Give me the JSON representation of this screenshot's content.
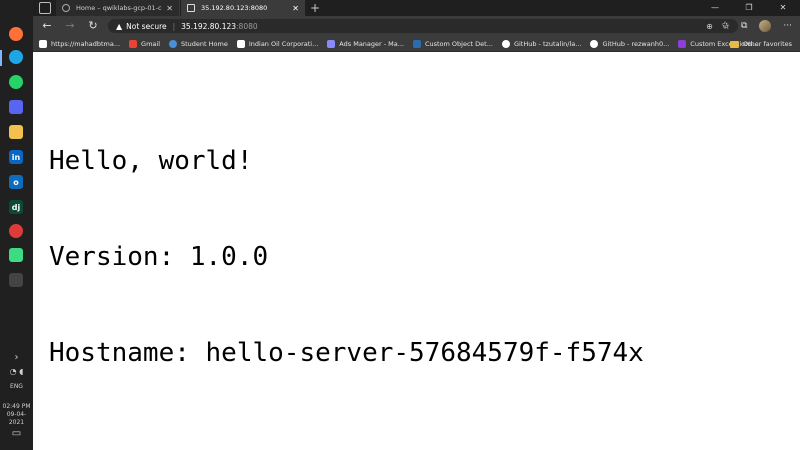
{
  "browser": {
    "tabs": [
      {
        "title": "Home – qwiklabs-gcp-01-c9e...",
        "active": false
      },
      {
        "title": "35.192.80.123:8080",
        "active": true
      }
    ],
    "new_tab": "+",
    "window_controls": {
      "minimize": "—",
      "restore": "❐",
      "close": "✕"
    },
    "nav": {
      "back": "←",
      "forward": "→",
      "refresh": "↻"
    },
    "address": {
      "security_label": "Not secure",
      "separator": "|",
      "host": "35.192.80.123",
      "port": ":8080"
    },
    "bookmarks": [
      {
        "label": "https://mahadbtma...",
        "icon": "page-icon",
        "color": "#ffffff"
      },
      {
        "label": "Gmail",
        "icon": "gmail-icon",
        "color": "#ea4335"
      },
      {
        "label": "Student Home",
        "icon": "globe-icon",
        "color": "#4a90d9"
      },
      {
        "label": "Indian Oil Corporati...",
        "icon": "page-icon",
        "color": "#ffffff"
      },
      {
        "label": "Ads Manager - Ma...",
        "icon": "ads-icon",
        "color": "#8a8aff"
      },
      {
        "label": "Custom Object Det...",
        "icon": "salesforce-icon",
        "color": "#2b6cb0"
      },
      {
        "label": "GitHub - tzutalin/la...",
        "icon": "github-icon",
        "color": "#ffffff"
      },
      {
        "label": "GitHub - rezwanh0...",
        "icon": "github-icon",
        "color": "#ffffff"
      },
      {
        "label": "Custom Exceptions...",
        "icon": "exceptions-icon",
        "color": "#8c3fd6"
      }
    ],
    "other_favorites": "Other favorites"
  },
  "page": {
    "lines": [
      "Hello, world!",
      "Version: 1.0.0",
      "Hostname: hello-server-57684579f-f574x"
    ]
  },
  "taskbar": {
    "apps": [
      {
        "name": "firefox-icon",
        "glyph": "",
        "color": "#ff7139"
      },
      {
        "name": "edge-icon",
        "glyph": "",
        "color": "#1fa6e8"
      },
      {
        "name": "whatsapp-icon",
        "glyph": "",
        "color": "#25d366"
      },
      {
        "name": "discord-icon",
        "glyph": "",
        "color": "#5865f2"
      },
      {
        "name": "file-explorer-icon",
        "glyph": "",
        "color": "#f2c14e"
      },
      {
        "name": "linkedin-icon",
        "glyph": "in",
        "color": "#0a66c2"
      },
      {
        "name": "outlook-icon",
        "glyph": "o",
        "color": "#0f6cbd"
      },
      {
        "name": "django-icon",
        "glyph": "dj",
        "color": "#0c4b33"
      },
      {
        "name": "red-app-icon",
        "glyph": "",
        "color": "#e03b3b"
      },
      {
        "name": "android-studio-icon",
        "glyph": "",
        "color": "#3ddc84"
      },
      {
        "name": "terminal-icon",
        "glyph": "",
        "color": "#444444"
      }
    ],
    "tray_chevron": "›",
    "language": "ENG",
    "time": "02:49 PM",
    "date": "09-04-2021"
  }
}
